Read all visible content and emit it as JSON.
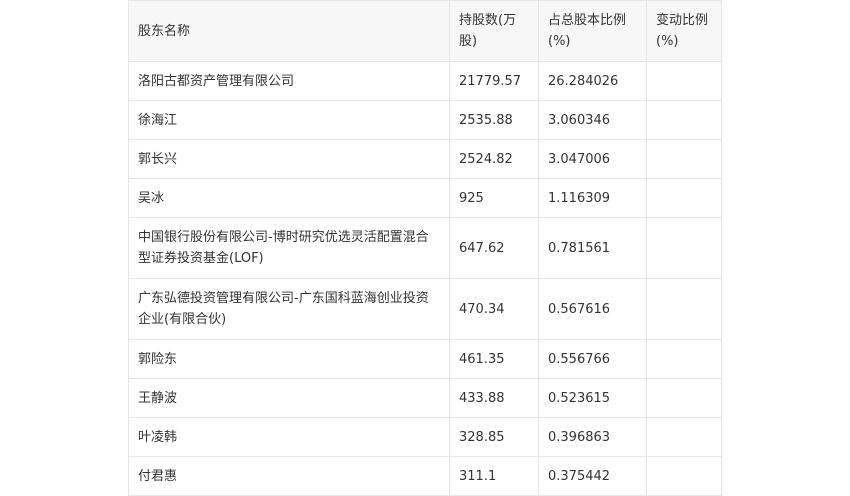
{
  "table": {
    "headers": [
      "股东名称",
      "持股数(万股)",
      "占总股本比例(%)",
      "变动比例(%)"
    ],
    "rows": [
      {
        "name": "洛阳古都资产管理有限公司",
        "shares": "21779.57",
        "ratio": "26.284026",
        "change": ""
      },
      {
        "name": "徐海江",
        "shares": "2535.88",
        "ratio": "3.060346",
        "change": ""
      },
      {
        "name": "郭长兴",
        "shares": "2524.82",
        "ratio": "3.047006",
        "change": ""
      },
      {
        "name": "吴冰",
        "shares": "925",
        "ratio": "1.116309",
        "change": ""
      },
      {
        "name": "中国银行股份有限公司-博时研究优选灵活配置混合型证券投资基金(LOF)",
        "shares": "647.62",
        "ratio": "0.781561",
        "change": ""
      },
      {
        "name": "广东弘德投资管理有限公司-广东国科蓝海创业投资企业(有限合伙)",
        "shares": "470.34",
        "ratio": "0.567616",
        "change": ""
      },
      {
        "name": "郭险东",
        "shares": "461.35",
        "ratio": "0.556766",
        "change": ""
      },
      {
        "name": "王静波",
        "shares": "433.88",
        "ratio": "0.523615",
        "change": ""
      },
      {
        "name": "叶凌韩",
        "shares": "328.85",
        "ratio": "0.396863",
        "change": ""
      },
      {
        "name": "付君惠",
        "shares": "311.1",
        "ratio": "0.375442",
        "change": ""
      }
    ]
  }
}
